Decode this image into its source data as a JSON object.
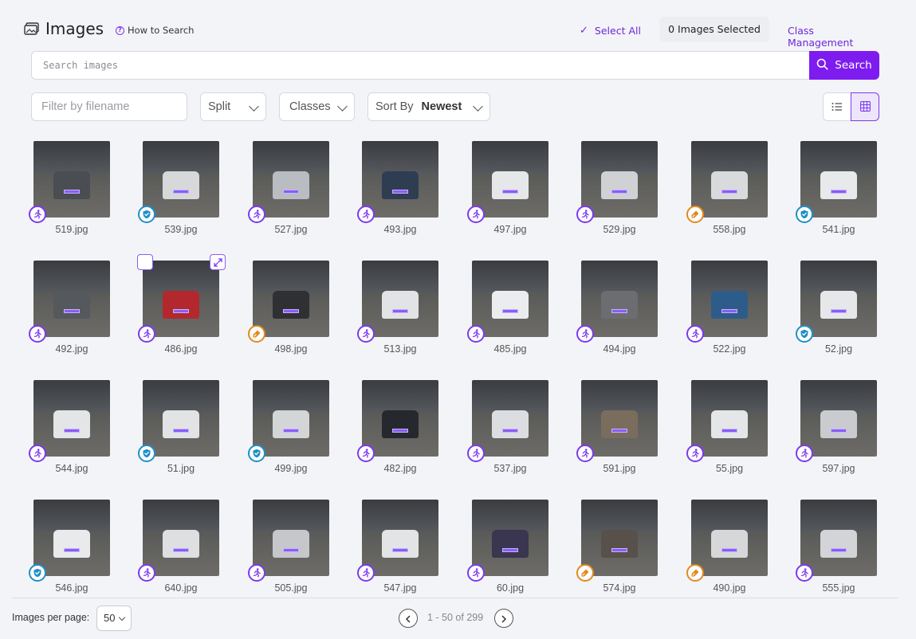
{
  "header": {
    "title": "Images",
    "how_to_search": "How to Search",
    "select_all": "Select All",
    "images_selected": "0 Images Selected",
    "class_management": "Class Management"
  },
  "search": {
    "placeholder": "Search images",
    "button_label": "Search"
  },
  "filters": {
    "filename_placeholder": "Filter by filename",
    "split_label": "Split",
    "classes_label": "Classes",
    "sort_by_label": "Sort By",
    "sort_by_value": "Newest"
  },
  "view": {
    "mode": "grid",
    "accent_color": "#7c3aed"
  },
  "split_colors": {
    "train": "#7c3aed",
    "valid": "#1f8fc9",
    "test": "#e08a1e"
  },
  "images": [
    {
      "name": "519.jpg",
      "split": "train",
      "car": "#4a4d52"
    },
    {
      "name": "539.jpg",
      "split": "valid",
      "car": "#d7d8da"
    },
    {
      "name": "527.jpg",
      "split": "train",
      "car": "#b9bcc0"
    },
    {
      "name": "493.jpg",
      "split": "train",
      "car": "#2f3d52"
    },
    {
      "name": "497.jpg",
      "split": "train",
      "car": "#e6e7e8"
    },
    {
      "name": "529.jpg",
      "split": "train",
      "car": "#cfd1d4"
    },
    {
      "name": "558.jpg",
      "split": "test",
      "car": "#d9dadc"
    },
    {
      "name": "541.jpg",
      "split": "valid",
      "car": "#e8e9ea"
    },
    {
      "name": "492.jpg",
      "split": "train",
      "car": "#55585c"
    },
    {
      "name": "486.jpg",
      "split": "train",
      "car": "#b3282c"
    },
    {
      "name": "498.jpg",
      "split": "test",
      "car": "#2e3034"
    },
    {
      "name": "513.jpg",
      "split": "train",
      "car": "#e2e3e5"
    },
    {
      "name": "485.jpg",
      "split": "train",
      "car": "#ebecee"
    },
    {
      "name": "494.jpg",
      "split": "train",
      "car": "#6b6d70"
    },
    {
      "name": "522.jpg",
      "split": "train",
      "car": "#2e5c8a"
    },
    {
      "name": "52.jpg",
      "split": "valid",
      "car": "#e6e7e8"
    },
    {
      "name": "544.jpg",
      "split": "train",
      "car": "#e4e5e7"
    },
    {
      "name": "51.jpg",
      "split": "valid",
      "car": "#e2e3e4"
    },
    {
      "name": "499.jpg",
      "split": "valid",
      "car": "#d4d5d7"
    },
    {
      "name": "482.jpg",
      "split": "train",
      "car": "#25282d"
    },
    {
      "name": "537.jpg",
      "split": "train",
      "car": "#dcdde0"
    },
    {
      "name": "591.jpg",
      "split": "train",
      "car": "#7a6d5e"
    },
    {
      "name": "55.jpg",
      "split": "train",
      "car": "#e5e6e8"
    },
    {
      "name": "597.jpg",
      "split": "train",
      "car": "#c9cbce"
    },
    {
      "name": "546.jpg",
      "split": "valid",
      "car": "#e9eaeb"
    },
    {
      "name": "640.jpg",
      "split": "train",
      "car": "#dedfe1"
    },
    {
      "name": "505.jpg",
      "split": "train",
      "car": "#c5c7ca"
    },
    {
      "name": "547.jpg",
      "split": "train",
      "car": "#e3e4e6"
    },
    {
      "name": "60.jpg",
      "split": "train",
      "car": "#3a3650"
    },
    {
      "name": "574.jpg",
      "split": "test",
      "car": "#58504a"
    },
    {
      "name": "490.jpg",
      "split": "test",
      "car": "#d6d7d9"
    },
    {
      "name": "555.jpg",
      "split": "train",
      "car": "#d2d4d7"
    }
  ],
  "footer": {
    "per_page_label": "Images per page:",
    "per_page_value": "50",
    "pagination": "1 - 50 of 299"
  }
}
